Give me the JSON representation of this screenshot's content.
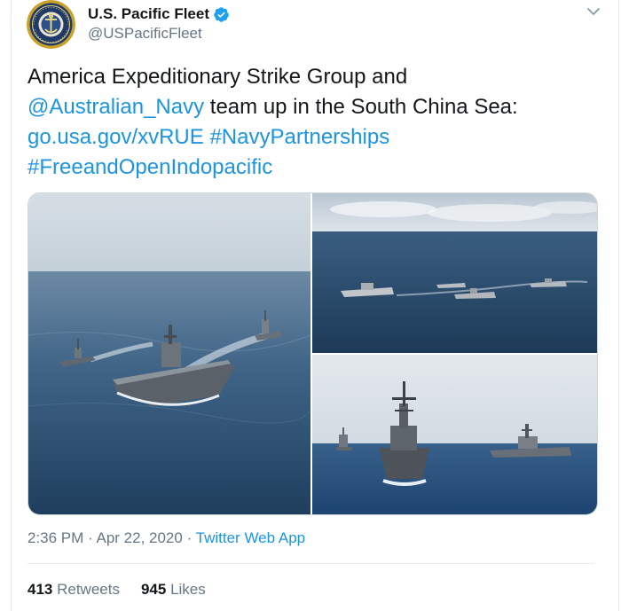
{
  "account": {
    "display_name": "U.S. Pacific Fleet",
    "handle": "@USPacificFleet",
    "verified": true,
    "avatar_icon": "navy-seal-icon"
  },
  "tweet": {
    "line1": "America Expeditionary Strike Group and",
    "mention": "@Australian_Navy",
    "line2_rest": " team up in the South China Sea:",
    "link": "go.usa.gov/xvRUE",
    "hashtag1": "#NavyPartnerships",
    "hashtag2": "#FreeandOpenIndopacific"
  },
  "meta": {
    "time": "2:36 PM",
    "separator": " · ",
    "date": "Apr 22, 2020",
    "app": "Twitter Web App"
  },
  "stats": {
    "retweets_count": "413",
    "retweets_label": " Retweets",
    "likes_count": "945",
    "likes_label": " Likes"
  },
  "colors": {
    "link": "#1b95e0",
    "verified": "#1da1f2",
    "muted": "#657786",
    "text": "#14171a"
  }
}
